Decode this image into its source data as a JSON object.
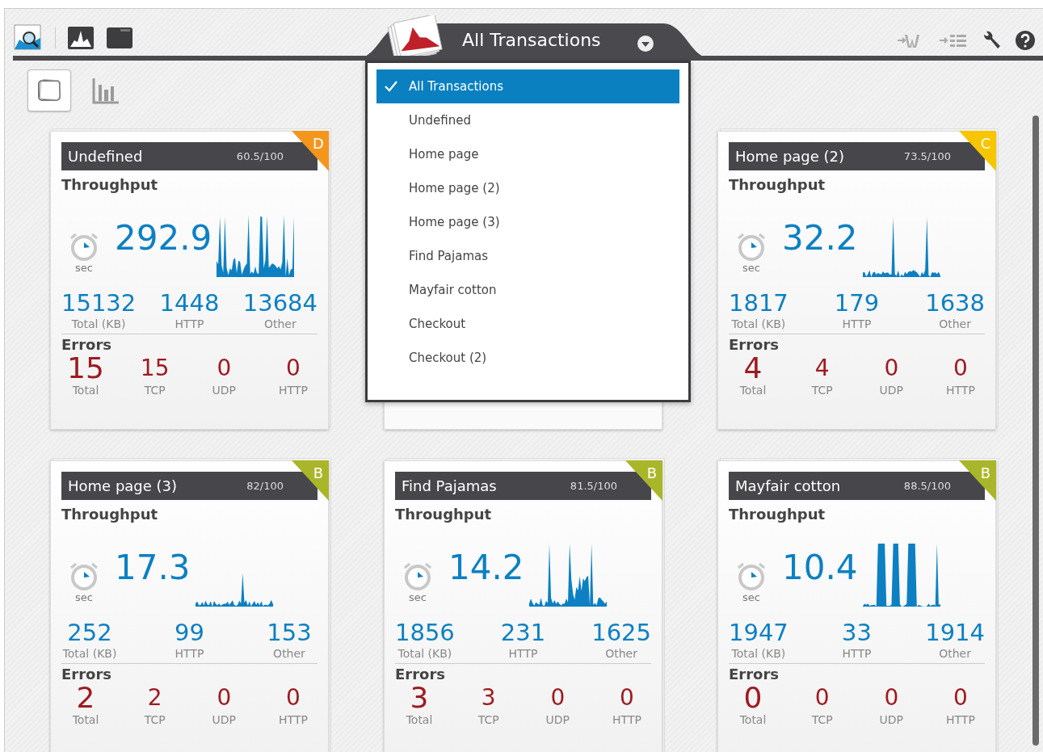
{
  "toolbar": {
    "title": "All Transactions"
  },
  "views": [
    {
      "kind": "cards",
      "selected": true
    },
    {
      "kind": "chart",
      "selected": false
    }
  ],
  "dropdown": {
    "items": [
      {
        "label": "All Transactions",
        "selected": true
      },
      {
        "label": "Undefined",
        "selected": false
      },
      {
        "label": "Home page",
        "selected": false
      },
      {
        "label": "Home page (2)",
        "selected": false
      },
      {
        "label": "Home page (3)",
        "selected": false
      },
      {
        "label": "Find Pajamas",
        "selected": false
      },
      {
        "label": "Mayfair cotton",
        "selected": false
      },
      {
        "label": "Checkout",
        "selected": false
      },
      {
        "label": "Checkout (2)",
        "selected": false
      }
    ]
  },
  "cards": [
    {
      "name": "Undefined",
      "score": "60.5/100",
      "grade": "D",
      "color": "#f4961c",
      "section": "Throughput",
      "throughput": "292.9",
      "unit": "sec",
      "traffic": [
        {
          "value": "15132",
          "label": "Total (KB)"
        },
        {
          "value": "1448",
          "label": "HTTP"
        },
        {
          "value": "13684",
          "label": "Other"
        }
      ],
      "errors_title": "Errors",
      "errors": [
        {
          "value": "15",
          "label": "Total"
        },
        {
          "value": "15",
          "label": "TCP"
        },
        {
          "value": "0",
          "label": "UDP"
        },
        {
          "value": "0",
          "label": "HTTP"
        }
      ]
    },
    {
      "name": "Home page (2)",
      "score": "73.5/100",
      "grade": "C",
      "color": "#f7c600",
      "section": "Throughput",
      "throughput": "32.2",
      "unit": "sec",
      "traffic": [
        {
          "value": "1817",
          "label": "Total (KB)"
        },
        {
          "value": "179",
          "label": "HTTP"
        },
        {
          "value": "1638",
          "label": "Other"
        }
      ],
      "errors_title": "Errors",
      "errors": [
        {
          "value": "4",
          "label": "Total"
        },
        {
          "value": "4",
          "label": "TCP"
        },
        {
          "value": "0",
          "label": "UDP"
        },
        {
          "value": "0",
          "label": "HTTP"
        }
      ]
    },
    {
      "name": "Home page (3)",
      "score": "82/100",
      "grade": "B",
      "color": "#a9b629",
      "section": "Throughput",
      "throughput": "17.3",
      "unit": "sec",
      "traffic": [
        {
          "value": "252",
          "label": "Total (KB)"
        },
        {
          "value": "99",
          "label": "HTTP"
        },
        {
          "value": "153",
          "label": "Other"
        }
      ],
      "errors_title": "Errors",
      "errors": [
        {
          "value": "2",
          "label": "Total"
        },
        {
          "value": "2",
          "label": "TCP"
        },
        {
          "value": "0",
          "label": "UDP"
        },
        {
          "value": "0",
          "label": "HTTP"
        }
      ]
    },
    {
      "name": "Find Pajamas",
      "score": "81.5/100",
      "grade": "B",
      "color": "#a9b629",
      "section": "Throughput",
      "throughput": "14.2",
      "unit": "sec",
      "traffic": [
        {
          "value": "1856",
          "label": "Total (KB)"
        },
        {
          "value": "231",
          "label": "HTTP"
        },
        {
          "value": "1625",
          "label": "Other"
        }
      ],
      "errors_title": "Errors",
      "errors": [
        {
          "value": "3",
          "label": "Total"
        },
        {
          "value": "3",
          "label": "TCP"
        },
        {
          "value": "0",
          "label": "UDP"
        },
        {
          "value": "0",
          "label": "HTTP"
        }
      ]
    },
    {
      "name": "Mayfair cotton",
      "score": "88.5/100",
      "grade": "B",
      "color": "#a9b629",
      "section": "Throughput",
      "throughput": "10.4",
      "unit": "sec",
      "traffic": [
        {
          "value": "1947",
          "label": "Total (KB)"
        },
        {
          "value": "33",
          "label": "HTTP"
        },
        {
          "value": "1914",
          "label": "Other"
        }
      ],
      "errors_title": "Errors",
      "errors": [
        {
          "value": "0",
          "label": "Total"
        },
        {
          "value": "0",
          "label": "TCP"
        },
        {
          "value": "0",
          "label": "UDP"
        },
        {
          "value": "0",
          "label": "HTTP"
        }
      ]
    }
  ]
}
